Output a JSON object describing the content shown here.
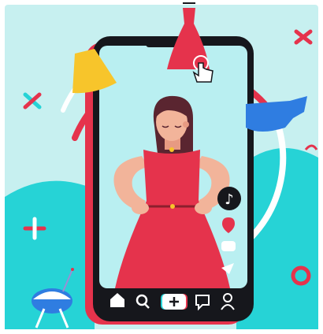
{
  "colors": {
    "background": "#c7f0f0",
    "teal": "#26d3d6",
    "red": "#e5334c",
    "dark": "#16171c",
    "skin": "#f2b49a",
    "hair": "#5a2530",
    "yellow": "#f7c52b",
    "blue": "#2f7de1",
    "screen": "#b9eff1"
  },
  "nav": {
    "items": [
      {
        "name": "home",
        "icon": "home-icon"
      },
      {
        "name": "search",
        "icon": "search-icon"
      },
      {
        "name": "create",
        "icon": "plus-icon"
      },
      {
        "name": "inbox",
        "icon": "message-icon"
      },
      {
        "name": "profile",
        "icon": "person-icon"
      }
    ]
  },
  "side_icons": [
    "tiktok-logo-icon",
    "heart-icon",
    "comment-icon",
    "share-icon"
  ],
  "decorations": [
    "cursor-hand-icon",
    "yellow-skirt",
    "red-dress",
    "blue-dress",
    "grill-icon"
  ]
}
